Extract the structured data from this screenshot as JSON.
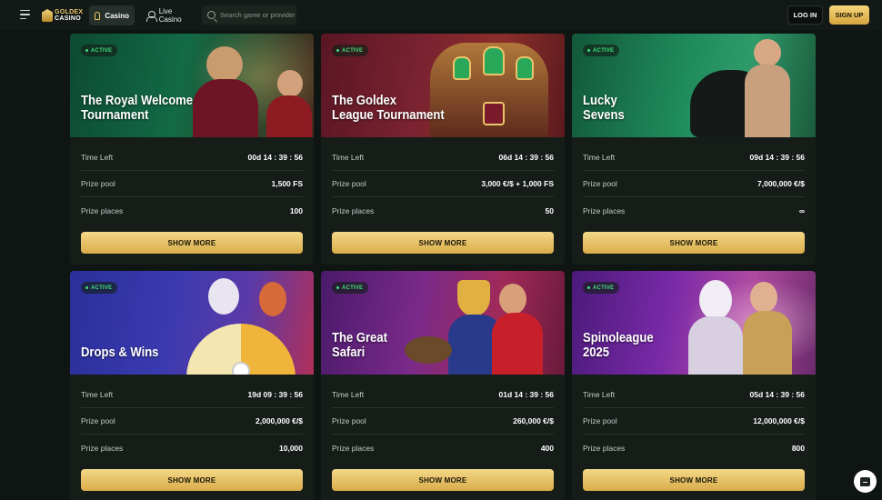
{
  "header": {
    "logo_line1": "GOLDEX",
    "logo_line2": "CASINO",
    "nav": [
      {
        "label": "Casino",
        "icon": "casino-icon",
        "active": true
      },
      {
        "label": "Live Casino",
        "icon": "live-casino-icon",
        "active": false
      }
    ],
    "search_placeholder": "Search game or provider",
    "login_label": "LOG IN",
    "signup_label": "SIGN UP"
  },
  "colors": {
    "accent_gold": "#e3b955",
    "active_green": "#3ee07a",
    "page_bg": "#0f1512",
    "card_bg": "#161d19"
  },
  "labels": {
    "time_left": "Time Left",
    "prize_pool": "Prize pool",
    "prize_places": "Prize places",
    "show_more": "SHOW MORE",
    "active": "ACTIVE"
  },
  "tournaments": [
    {
      "title_line1": "The Royal Welcome",
      "title_line2": "Tournament",
      "status": "ACTIVE",
      "time_left": "00d  14 : 39 : 56",
      "prize_pool": "1,500 FS",
      "prize_places": "100"
    },
    {
      "title_line1": "The Goldex",
      "title_line2": "League Tournament",
      "status": "ACTIVE",
      "time_left": "06d  14 : 39 : 56",
      "prize_pool": "3,000 €/$ + 1,000 FS",
      "prize_places": "50"
    },
    {
      "title_line1": "Lucky",
      "title_line2": "Sevens",
      "status": "ACTIVE",
      "time_left": "09d  14 : 39 : 56",
      "prize_pool": "7,000,000 €/$",
      "prize_places": "∞"
    },
    {
      "title_line1": "Drops & Wins",
      "title_line2": "",
      "status": "ACTIVE",
      "time_left": "19d  09 : 39 : 56",
      "prize_pool": "2,000,000 €/$",
      "prize_places": "10,000"
    },
    {
      "title_line1": "The Great",
      "title_line2": "Safari",
      "status": "ACTIVE",
      "time_left": "01d  14 : 39 : 56",
      "prize_pool": "260,000 €/$",
      "prize_places": "400"
    },
    {
      "title_line1": "Spinoleague",
      "title_line2": "2025",
      "status": "ACTIVE",
      "time_left": "05d  14 : 39 : 56",
      "prize_pool": "12,000,000 €/$",
      "prize_places": "800"
    }
  ]
}
